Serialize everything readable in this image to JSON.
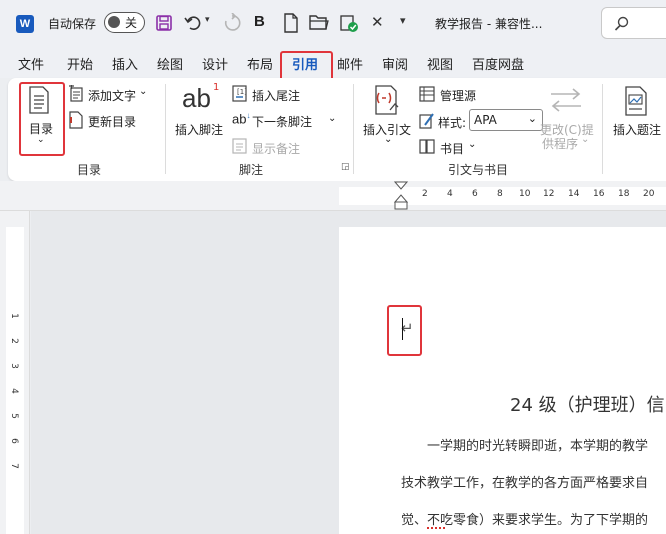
{
  "titlebar": {
    "app_icon": "word-icon",
    "autosave_label": "自动保存",
    "autosave_state": "关",
    "doc_title": "教学报告 - 兼容性...",
    "search_icon": "search-icon"
  },
  "menu": {
    "tabs": [
      "文件",
      "开始",
      "插入",
      "绘图",
      "设计",
      "布局",
      "引用",
      "邮件",
      "审阅",
      "视图",
      "百度网盘"
    ],
    "active": "引用"
  },
  "ribbon": {
    "toc": {
      "button_label": "目录",
      "add_text": "添加文字",
      "update_toc": "更新目录",
      "group_label": "目录"
    },
    "footnotes": {
      "ab_glyph": "ab",
      "superscript": "1",
      "insert_footnote": "插入脚注",
      "insert_endnote": "插入尾注",
      "next_footnote": "下一条脚注",
      "show_notes": "显示备注",
      "group_label": "脚注"
    },
    "citations": {
      "insert_citation": "插入引文",
      "manage_sources": "管理源",
      "style_label": "样式:",
      "style_value": "APA",
      "bibliography": "书目",
      "update_citations_1": "更改(C)提",
      "update_citations_2": "供程序",
      "group_label": "引文与书目"
    },
    "captions": {
      "insert_caption": "插入题注"
    }
  },
  "ruler": {
    "top_ticks": [
      "2",
      "4",
      "6",
      "8",
      "10",
      "12",
      "14",
      "16",
      "18",
      "20"
    ],
    "left_ticks": [
      "1",
      "2",
      "3",
      "4",
      "5",
      "6",
      "7"
    ]
  },
  "document": {
    "paragraph_mark": "↵",
    "heading": "24 级（护理班）信",
    "line1": "一学期的时光转瞬即逝，本学期的教学",
    "line2": "技术教学工作，在教学的各方面严格要求自",
    "line3": "觉、不吃零食）来要求学生。为了下学期的"
  },
  "colors": {
    "accent": "#185abd",
    "highlight": "#e0353b",
    "word_blue": "#185abd"
  }
}
